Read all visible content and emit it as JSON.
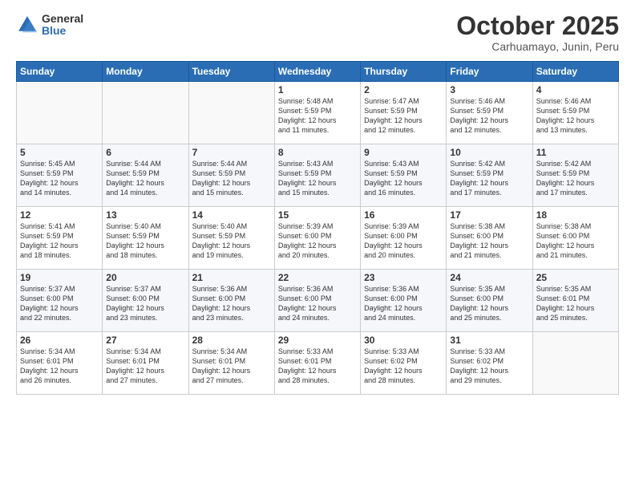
{
  "logo": {
    "general": "General",
    "blue": "Blue"
  },
  "title": "October 2025",
  "subtitle": "Carhuamayo, Junin, Peru",
  "weekdays": [
    "Sunday",
    "Monday",
    "Tuesday",
    "Wednesday",
    "Thursday",
    "Friday",
    "Saturday"
  ],
  "weeks": [
    [
      {
        "day": "",
        "info": ""
      },
      {
        "day": "",
        "info": ""
      },
      {
        "day": "",
        "info": ""
      },
      {
        "day": "1",
        "info": "Sunrise: 5:48 AM\nSunset: 5:59 PM\nDaylight: 12 hours\nand 11 minutes."
      },
      {
        "day": "2",
        "info": "Sunrise: 5:47 AM\nSunset: 5:59 PM\nDaylight: 12 hours\nand 12 minutes."
      },
      {
        "day": "3",
        "info": "Sunrise: 5:46 AM\nSunset: 5:59 PM\nDaylight: 12 hours\nand 12 minutes."
      },
      {
        "day": "4",
        "info": "Sunrise: 5:46 AM\nSunset: 5:59 PM\nDaylight: 12 hours\nand 13 minutes."
      }
    ],
    [
      {
        "day": "5",
        "info": "Sunrise: 5:45 AM\nSunset: 5:59 PM\nDaylight: 12 hours\nand 14 minutes."
      },
      {
        "day": "6",
        "info": "Sunrise: 5:44 AM\nSunset: 5:59 PM\nDaylight: 12 hours\nand 14 minutes."
      },
      {
        "day": "7",
        "info": "Sunrise: 5:44 AM\nSunset: 5:59 PM\nDaylight: 12 hours\nand 15 minutes."
      },
      {
        "day": "8",
        "info": "Sunrise: 5:43 AM\nSunset: 5:59 PM\nDaylight: 12 hours\nand 15 minutes."
      },
      {
        "day": "9",
        "info": "Sunrise: 5:43 AM\nSunset: 5:59 PM\nDaylight: 12 hours\nand 16 minutes."
      },
      {
        "day": "10",
        "info": "Sunrise: 5:42 AM\nSunset: 5:59 PM\nDaylight: 12 hours\nand 17 minutes."
      },
      {
        "day": "11",
        "info": "Sunrise: 5:42 AM\nSunset: 5:59 PM\nDaylight: 12 hours\nand 17 minutes."
      }
    ],
    [
      {
        "day": "12",
        "info": "Sunrise: 5:41 AM\nSunset: 5:59 PM\nDaylight: 12 hours\nand 18 minutes."
      },
      {
        "day": "13",
        "info": "Sunrise: 5:40 AM\nSunset: 5:59 PM\nDaylight: 12 hours\nand 18 minutes."
      },
      {
        "day": "14",
        "info": "Sunrise: 5:40 AM\nSunset: 5:59 PM\nDaylight: 12 hours\nand 19 minutes."
      },
      {
        "day": "15",
        "info": "Sunrise: 5:39 AM\nSunset: 6:00 PM\nDaylight: 12 hours\nand 20 minutes."
      },
      {
        "day": "16",
        "info": "Sunrise: 5:39 AM\nSunset: 6:00 PM\nDaylight: 12 hours\nand 20 minutes."
      },
      {
        "day": "17",
        "info": "Sunrise: 5:38 AM\nSunset: 6:00 PM\nDaylight: 12 hours\nand 21 minutes."
      },
      {
        "day": "18",
        "info": "Sunrise: 5:38 AM\nSunset: 6:00 PM\nDaylight: 12 hours\nand 21 minutes."
      }
    ],
    [
      {
        "day": "19",
        "info": "Sunrise: 5:37 AM\nSunset: 6:00 PM\nDaylight: 12 hours\nand 22 minutes."
      },
      {
        "day": "20",
        "info": "Sunrise: 5:37 AM\nSunset: 6:00 PM\nDaylight: 12 hours\nand 23 minutes."
      },
      {
        "day": "21",
        "info": "Sunrise: 5:36 AM\nSunset: 6:00 PM\nDaylight: 12 hours\nand 23 minutes."
      },
      {
        "day": "22",
        "info": "Sunrise: 5:36 AM\nSunset: 6:00 PM\nDaylight: 12 hours\nand 24 minutes."
      },
      {
        "day": "23",
        "info": "Sunrise: 5:36 AM\nSunset: 6:00 PM\nDaylight: 12 hours\nand 24 minutes."
      },
      {
        "day": "24",
        "info": "Sunrise: 5:35 AM\nSunset: 6:00 PM\nDaylight: 12 hours\nand 25 minutes."
      },
      {
        "day": "25",
        "info": "Sunrise: 5:35 AM\nSunset: 6:01 PM\nDaylight: 12 hours\nand 25 minutes."
      }
    ],
    [
      {
        "day": "26",
        "info": "Sunrise: 5:34 AM\nSunset: 6:01 PM\nDaylight: 12 hours\nand 26 minutes."
      },
      {
        "day": "27",
        "info": "Sunrise: 5:34 AM\nSunset: 6:01 PM\nDaylight: 12 hours\nand 27 minutes."
      },
      {
        "day": "28",
        "info": "Sunrise: 5:34 AM\nSunset: 6:01 PM\nDaylight: 12 hours\nand 27 minutes."
      },
      {
        "day": "29",
        "info": "Sunrise: 5:33 AM\nSunset: 6:01 PM\nDaylight: 12 hours\nand 28 minutes."
      },
      {
        "day": "30",
        "info": "Sunrise: 5:33 AM\nSunset: 6:02 PM\nDaylight: 12 hours\nand 28 minutes."
      },
      {
        "day": "31",
        "info": "Sunrise: 5:33 AM\nSunset: 6:02 PM\nDaylight: 12 hours\nand 29 minutes."
      },
      {
        "day": "",
        "info": ""
      }
    ]
  ]
}
